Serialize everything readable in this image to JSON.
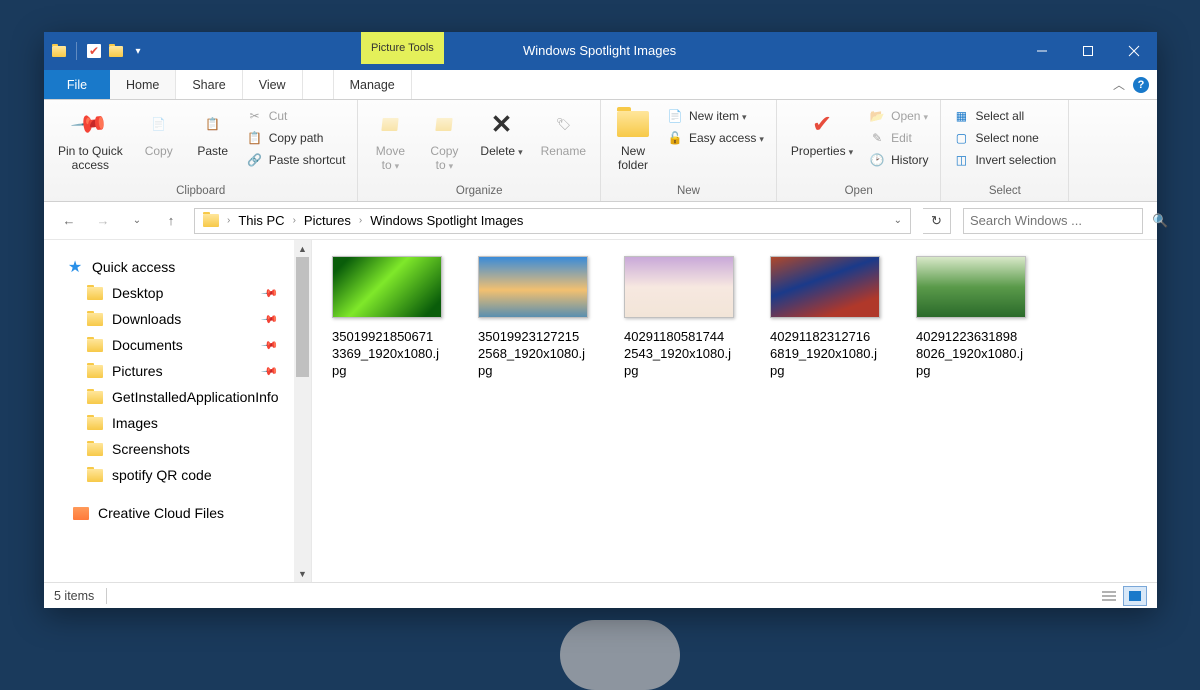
{
  "titlebar": {
    "context_tab": "Picture Tools",
    "title": "Windows Spotlight Images"
  },
  "tabs": {
    "file": "File",
    "home": "Home",
    "share": "Share",
    "view": "View",
    "manage": "Manage"
  },
  "ribbon": {
    "clipboard": {
      "label": "Clipboard",
      "pin": "Pin to Quick\naccess",
      "copy": "Copy",
      "paste": "Paste",
      "cut": "Cut",
      "copy_path": "Copy path",
      "paste_shortcut": "Paste shortcut"
    },
    "organize": {
      "label": "Organize",
      "move_to": "Move\nto",
      "copy_to": "Copy\nto",
      "delete": "Delete",
      "rename": "Rename"
    },
    "new": {
      "label": "New",
      "new_folder": "New\nfolder",
      "new_item": "New item",
      "easy_access": "Easy access"
    },
    "open": {
      "label": "Open",
      "properties": "Properties",
      "open": "Open",
      "edit": "Edit",
      "history": "History"
    },
    "select": {
      "label": "Select",
      "select_all": "Select all",
      "select_none": "Select none",
      "invert": "Invert selection"
    }
  },
  "breadcrumb": {
    "items": [
      "This PC",
      "Pictures",
      "Windows Spotlight Images"
    ]
  },
  "search": {
    "placeholder": "Search Windows ..."
  },
  "sidebar": {
    "quick_access": "Quick access",
    "items": [
      {
        "label": "Desktop",
        "pinned": true
      },
      {
        "label": "Downloads",
        "pinned": true
      },
      {
        "label": "Documents",
        "pinned": true
      },
      {
        "label": "Pictures",
        "pinned": true
      },
      {
        "label": "GetInstalledApplicationInfo",
        "pinned": false
      },
      {
        "label": "Images",
        "pinned": false
      },
      {
        "label": "Screenshots",
        "pinned": false
      },
      {
        "label": "spotify QR code",
        "pinned": false
      }
    ],
    "creative_cloud": "Creative Cloud Files"
  },
  "files": [
    {
      "name": "35019921850671\n3369_1920x1080.j\npg",
      "grad": "g1"
    },
    {
      "name": "35019923127215\n2568_1920x1080.j\npg",
      "grad": "g2"
    },
    {
      "name": "40291180581744\n2543_1920x1080.j\npg",
      "grad": "g3"
    },
    {
      "name": "40291182312716\n6819_1920x1080.j\npg",
      "grad": "g4"
    },
    {
      "name": "40291223631898\n8026_1920x1080.j\npg",
      "grad": "g5"
    }
  ],
  "status": {
    "count": "5 items"
  }
}
